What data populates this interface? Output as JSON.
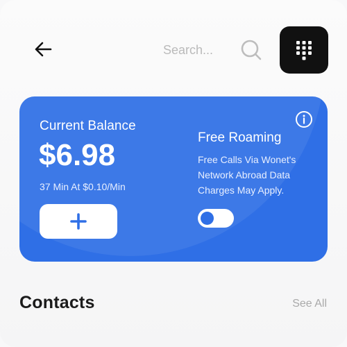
{
  "header": {
    "search_placeholder": "Search..."
  },
  "balance_card": {
    "balance_label": "Current Balance",
    "balance_amount": "$6.98",
    "rate_text": "37 Min At $0.10/Min",
    "roaming_title": "Free Roaming",
    "roaming_description": "Free Calls Via Wonet's Network Abroad Data Charges May Apply.",
    "roaming_enabled": false,
    "card_color": "#2f6fe6"
  },
  "contacts": {
    "title": "Contacts",
    "see_all_label": "See All"
  },
  "icons": {
    "back": "arrow-left-icon",
    "search": "search-icon",
    "dialpad": "dialpad-icon",
    "add": "plus-icon",
    "info": "info-icon"
  }
}
